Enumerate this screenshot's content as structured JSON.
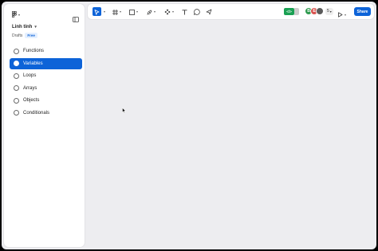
{
  "sidebar": {
    "project_name": "Linh tinh",
    "location": "Drafts",
    "plan_badge": "Free",
    "items": [
      {
        "label": "Functions",
        "active": false
      },
      {
        "label": "Variables",
        "active": true
      },
      {
        "label": "Loops",
        "active": false
      },
      {
        "label": "Arrays",
        "active": false
      },
      {
        "label": "Objects",
        "active": false
      },
      {
        "label": "Conditionals",
        "active": false
      }
    ]
  },
  "toolbar": {
    "dev_mode_label": "</>",
    "avatars": [
      {
        "initial": "B",
        "color": "#2e9a4f"
      },
      {
        "initial": "E",
        "color": "#d9534f"
      },
      {
        "initial": "",
        "color": "#5a5a5a"
      }
    ],
    "collaborator_count": "5",
    "share_label": "Share"
  },
  "colors": {
    "accent": "#0d63d8",
    "dev_mode": "#1aa053",
    "canvas": "#ededf0"
  }
}
